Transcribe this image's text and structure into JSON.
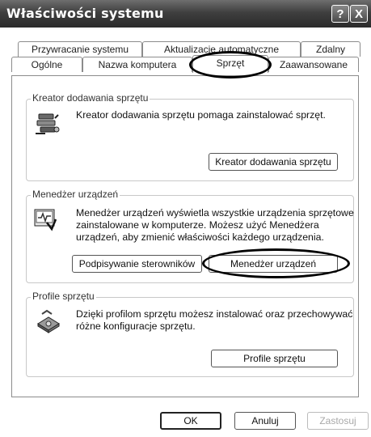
{
  "window": {
    "title": "Właściwości systemu"
  },
  "titlebar_buttons": {
    "help": "?",
    "close": "X"
  },
  "tabs": [
    {
      "label": "Przywracanie systemu"
    },
    {
      "label": "Aktualizacje automatyczne"
    },
    {
      "label": "Zdalny"
    },
    {
      "label": "Ogólne"
    },
    {
      "label": "Nazwa komputera"
    },
    {
      "label": "Sprzęt",
      "active": true
    },
    {
      "label": "Zaawansowane"
    }
  ],
  "wizard_group": {
    "legend": "Kreator dodawania sprzętu",
    "description": "Kreator dodawania sprzętu pomaga zainstalować sprzęt.",
    "button": "Kreator dodawania sprzętu",
    "icon": "hardware-wizard-icon"
  },
  "device_manager_group": {
    "legend": "Menedżer urządzeń",
    "description_lines": [
      "Menedżer urządzeń wyświetla wszystkie urządzenia sprzętowe",
      "zainstalowane w komputerze. Możesz użyć Menedżera",
      "urządzeń, aby zmienić właściwości każdego urządzenia."
    ],
    "driver_signing_button": "Podpisywanie sterowników",
    "device_manager_button": "Menedżer urządzeń",
    "icon": "device-manager-icon"
  },
  "profiles_group": {
    "legend": "Profile sprzętu",
    "description_lines": [
      "Dzięki profilom sprzętu możesz instalować oraz przechowywać",
      "różne konfiguracje sprzętu."
    ],
    "button": "Profile sprzętu",
    "icon": "hardware-profiles-icon"
  },
  "dialog_buttons": {
    "ok": "OK",
    "cancel": "Anuluj",
    "apply": "Zastosuj"
  }
}
